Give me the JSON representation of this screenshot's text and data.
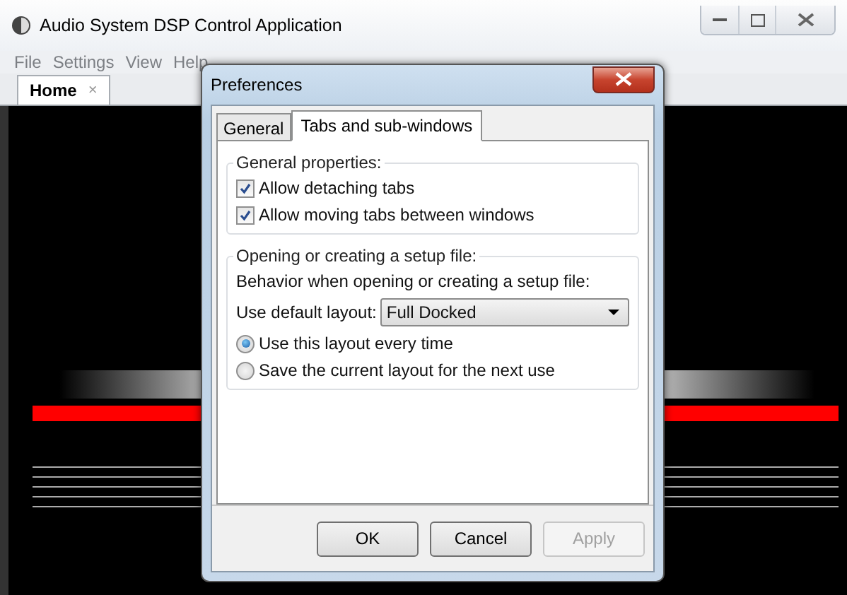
{
  "window": {
    "title": "Audio System DSP Control Application"
  },
  "menu": [
    "File",
    "Settings",
    "View",
    "Help"
  ],
  "document_tabs": [
    {
      "label": "Home",
      "close": "×",
      "selected": true
    }
  ],
  "dialog": {
    "title": "Preferences",
    "tabs": [
      {
        "label": "General",
        "selected": false
      },
      {
        "label": "Tabs and sub-windows",
        "selected": true
      }
    ],
    "general_group": {
      "title": "General properties:",
      "options": [
        {
          "label": "Allow detaching tabs",
          "checked": true
        },
        {
          "label": "Allow moving tabs between windows",
          "checked": true
        }
      ]
    },
    "setup_group": {
      "title": "Opening or creating a setup file:",
      "description": "Behavior when opening or creating a setup file:",
      "layout_field": {
        "label": "Use default layout:",
        "value": "Full Docked"
      },
      "choices": [
        {
          "label": "Use this layout every time",
          "selected": true
        },
        {
          "label": "Save the current layout for the next use",
          "selected": false
        }
      ]
    },
    "buttons": [
      {
        "label": "OK",
        "disabled": false
      },
      {
        "label": "Cancel",
        "disabled": false
      },
      {
        "label": "Apply",
        "disabled": true
      }
    ]
  }
}
